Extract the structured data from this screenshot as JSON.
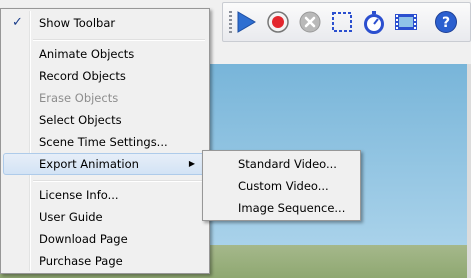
{
  "toolbar": {
    "buttons": [
      {
        "icon": "play-icon",
        "color": "#2f6fd1"
      },
      {
        "icon": "record-icon",
        "color": "#e3262d"
      },
      {
        "icon": "erase-icon",
        "color": "#b9b9b9"
      },
      {
        "icon": "select-icon",
        "color": "#2b4fcf"
      },
      {
        "icon": "stopwatch-icon",
        "color": "#2b4fcf"
      },
      {
        "icon": "film-icon",
        "color": "#2b4fcf"
      },
      {
        "icon": "help-icon",
        "color": "#2b5fcf"
      }
    ]
  },
  "menu": {
    "check_mark": "✓",
    "items": [
      {
        "label": "Show Toolbar",
        "checked": true
      },
      {
        "label": "Animate Objects"
      },
      {
        "label": "Record Objects"
      },
      {
        "label": "Erase Objects",
        "disabled": true
      },
      {
        "label": "Select Objects"
      },
      {
        "label": "Scene Time Settings..."
      },
      {
        "label": "Export Animation",
        "submenu": true
      },
      {
        "label": "License Info..."
      },
      {
        "label": "User Guide"
      },
      {
        "label": "Download Page"
      },
      {
        "label": "Purchase Page"
      }
    ],
    "submenu_arrow": "▶"
  },
  "submenu": {
    "items": [
      {
        "label": "Standard Video..."
      },
      {
        "label": "Custom Video..."
      },
      {
        "label": "Image Sequence..."
      }
    ]
  }
}
